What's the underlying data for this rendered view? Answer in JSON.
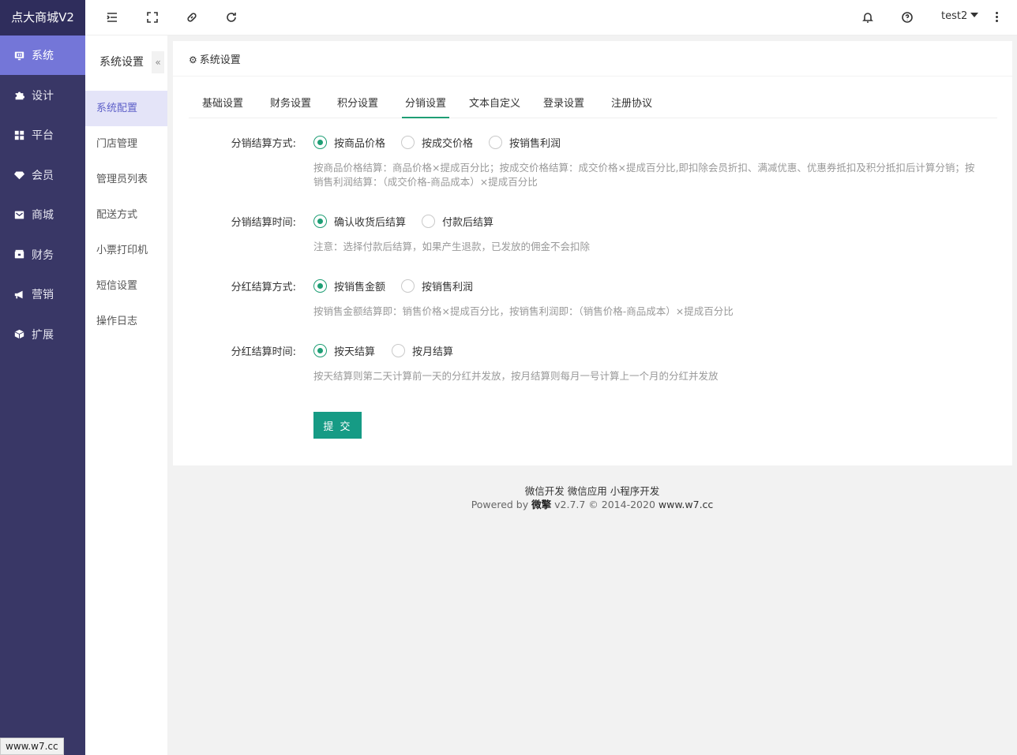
{
  "brand": "点大商城V2",
  "nav": [
    {
      "label": "系统",
      "icon": "monitor-icon",
      "active": true
    },
    {
      "label": "设计",
      "icon": "puzzle-icon"
    },
    {
      "label": "平台",
      "icon": "grid-icon"
    },
    {
      "label": "会员",
      "icon": "diamond-icon"
    },
    {
      "label": "商城",
      "icon": "mail-box-icon"
    },
    {
      "label": "财务",
      "icon": "wallet-icon"
    },
    {
      "label": "营销",
      "icon": "megaphone-icon"
    },
    {
      "label": "扩展",
      "icon": "cube-icon"
    }
  ],
  "header": {
    "icons": [
      "menu-indent-icon",
      "fullscreen-icon",
      "link-icon",
      "refresh-icon",
      "bell-icon",
      "help-icon"
    ],
    "user": "test2"
  },
  "subnav": {
    "title": "系统设置",
    "collapse": "«",
    "items": [
      "系统配置",
      "门店管理",
      "管理员列表",
      "配送方式",
      "小票打印机",
      "短信设置",
      "操作日志"
    ]
  },
  "card": {
    "title": "系统设置",
    "tabs": [
      "基础设置",
      "财务设置",
      "积分设置",
      "分销设置",
      "文本自定义",
      "登录设置",
      "注册协议"
    ],
    "active_tab": "分销设置"
  },
  "form": {
    "row1": {
      "label": "分销结算方式:",
      "options": [
        "按商品价格",
        "按成交价格",
        "按销售利润"
      ],
      "selected": "按商品价格",
      "hint_line1": "按商品价格结算：商品价格×提成百分比；按成交价格结算：成交价格×提成百分比,即扣除会员折扣、满减优惠、优惠券抵扣及积分抵扣后计算分销；按",
      "hint_line2": "销售利润结算：（成交价格-商品成本）×提成百分比"
    },
    "row2": {
      "label": "分销结算时间:",
      "options": [
        "确认收货后结算",
        "付款后结算"
      ],
      "selected": "确认收货后结算",
      "hint": "注意：选择付款后结算，如果产生退款，已发放的佣金不会扣除"
    },
    "row3": {
      "label": "分红结算方式:",
      "options": [
        "按销售金额",
        "按销售利润"
      ],
      "selected": "按销售金额",
      "hint": "按销售金额结算即：销售价格×提成百分比，按销售利润即：（销售价格-商品成本）×提成百分比"
    },
    "row4": {
      "label": "分红结算时间:",
      "options": [
        "按天结算",
        "按月结算"
      ],
      "selected": "按天结算",
      "hint": "按天结算则第二天计算前一天的分红并发放，按月结算则每月一号计算上一个月的分红并发放"
    },
    "submit": "提 交"
  },
  "footer": {
    "links": [
      "微信开发",
      "微信应用",
      "小程序开发"
    ],
    "powered_prefix": "Powered by",
    "powered_brand": "微擎",
    "powered_suffix": "v2.7.7 © 2014-2020",
    "site": "www.w7.cc"
  },
  "status_url": "www.w7.cc",
  "colors": {
    "nav_bg": "#393766",
    "nav_active": "#7476d8",
    "accent": "#1e9e74",
    "submit": "#169b85"
  }
}
